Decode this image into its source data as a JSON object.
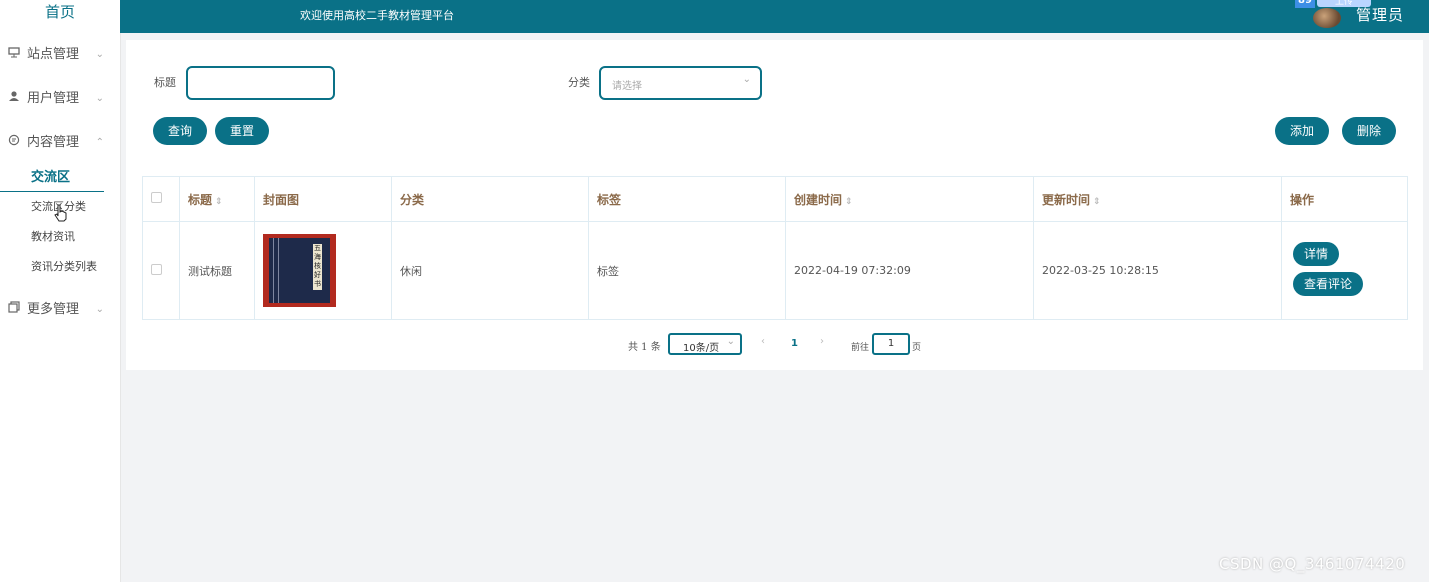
{
  "sidebar": {
    "brand": "首页",
    "groups": [
      {
        "label": "站点管理",
        "icon": "monitor-icon"
      },
      {
        "label": "用户管理",
        "icon": "user-icon"
      },
      {
        "label": "内容管理",
        "icon": "chat-icon"
      },
      {
        "label": "更多管理",
        "icon": "copy-icon"
      }
    ],
    "content_items": [
      {
        "label": "交流区",
        "active": true
      },
      {
        "label": "交流区分类",
        "active": false
      },
      {
        "label": "教材资讯",
        "active": false
      },
      {
        "label": "资讯分类列表",
        "active": false
      }
    ]
  },
  "topbar": {
    "welcome": "欢迎使用高校二手教材管理平台",
    "badge": "89",
    "upload_chip": "上传",
    "admin": "管理员"
  },
  "search": {
    "title_label": "标题",
    "title_value": "",
    "category_label": "分类",
    "category_placeholder": "请选择",
    "query_button": "查询",
    "reset_button": "重置",
    "add_button": "添加",
    "delete_button": "删除"
  },
  "table": {
    "headers": {
      "title": "标题",
      "cover": "封面图",
      "category": "分类",
      "tags": "标签",
      "created": "创建时间",
      "updated": "更新时间",
      "actions": "操作"
    },
    "rows": [
      {
        "title": "测试标题",
        "cover_text": "五海核好书",
        "category": "休闲",
        "tags": "标签",
        "created": "2022-04-19 07:32:09",
        "updated": "2022-03-25 10:28:15",
        "detail_button": "详情",
        "comments_button": "查看评论"
      }
    ]
  },
  "pagination": {
    "total": "共 1 条",
    "page_size": "10条/页",
    "current_page": "1",
    "goto_label": "前往",
    "goto_value": "1",
    "page_suffix": "页"
  },
  "watermark": "CSDN @Q_3461074420",
  "colors": {
    "primary": "#0a7187",
    "header_text": "#8b6a4a"
  }
}
